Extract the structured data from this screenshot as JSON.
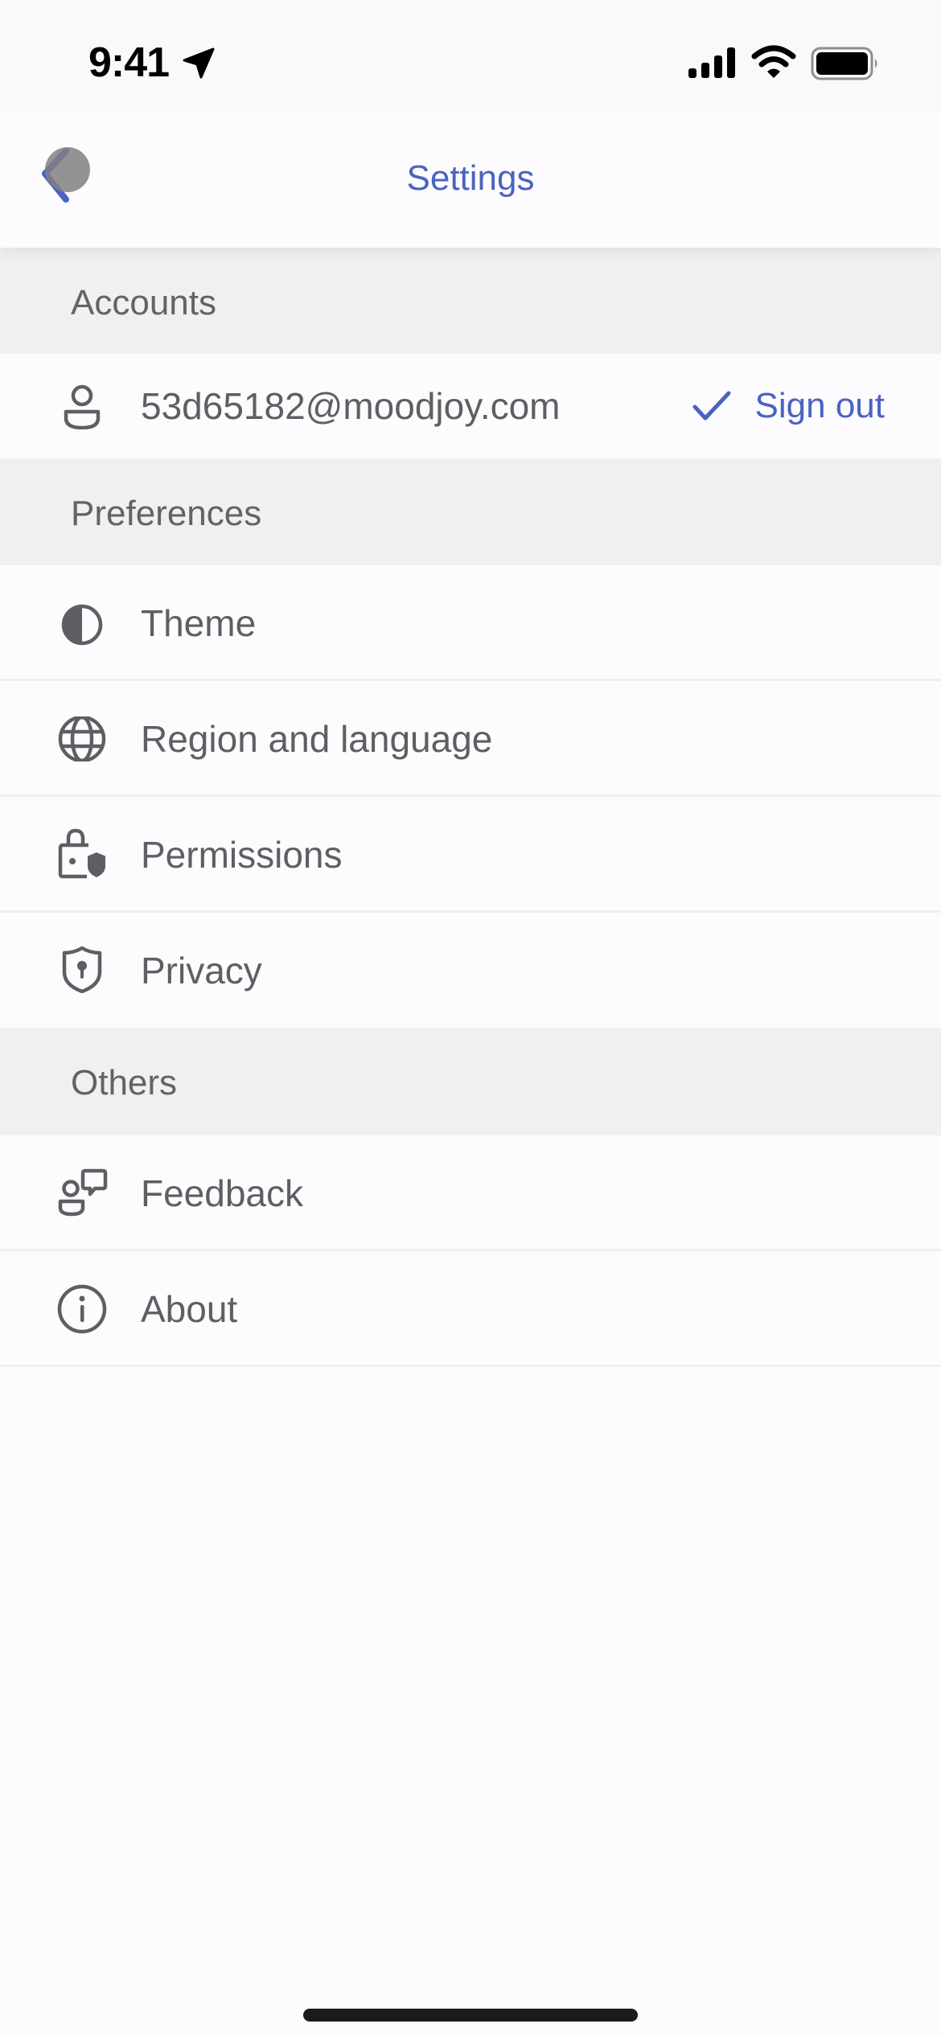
{
  "status_bar": {
    "time": "9:41",
    "icons": [
      "location-arrow-icon",
      "cellular-signal-icon",
      "wifi-icon",
      "battery-full-icon"
    ]
  },
  "header": {
    "title": "Settings",
    "back_icon": "chevron-left-icon"
  },
  "sections": [
    {
      "title": "Accounts",
      "items": [
        {
          "label": "53d65182@moodjoy.com",
          "icon": "person-icon",
          "action_label": "Sign out",
          "action_icon": "checkmark-icon"
        }
      ]
    },
    {
      "title": "Preferences",
      "items": [
        {
          "label": "Theme",
          "icon": "half-circle-contrast-icon"
        },
        {
          "label": "Region and language",
          "icon": "globe-icon"
        },
        {
          "label": "Permissions",
          "icon": "lock-shield-icon"
        },
        {
          "label": "Privacy",
          "icon": "shield-keyhole-icon"
        }
      ]
    },
    {
      "title": "Others",
      "items": [
        {
          "label": "Feedback",
          "icon": "person-speech-bubble-icon"
        },
        {
          "label": "About",
          "icon": "info-circle-icon"
        }
      ]
    }
  ],
  "colors": {
    "accent": "#4a63c2",
    "text": "#5f5e62",
    "section_background": "#f0eff2",
    "row_background": "#fcfbfd"
  }
}
